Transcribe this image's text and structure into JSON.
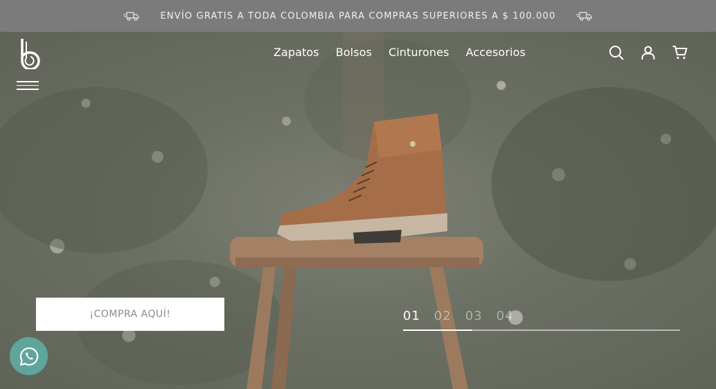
{
  "promo": {
    "text": "ENVÍO GRATIS A TODA COLOMBIA PARA COMPRAS SUPERIORES A $ 100.000",
    "left_icon": "delivery-truck-icon",
    "right_icon": "delivery-truck-icon"
  },
  "header": {
    "logo_icon": "brand-b-logo",
    "menu_icon": "hamburger-icon",
    "nav": [
      {
        "label": "Zapatos"
      },
      {
        "label": "Bolsos"
      },
      {
        "label": "Cinturones"
      },
      {
        "label": "Accesorios"
      }
    ],
    "icons": [
      "search-icon",
      "user-icon",
      "cart-icon"
    ]
  },
  "hero": {
    "cta_label": "¡COMPRA AQUÍ!",
    "slides": [
      "01",
      "02",
      "03",
      "04"
    ],
    "active_slide": "01",
    "progress_fraction": 0.25
  },
  "whatsapp": {
    "icon": "whatsapp-icon"
  },
  "colors": {
    "promo_bg": "#7b7b7b",
    "whatsapp": "#5fa59b",
    "cta_text": "#8a8a8a"
  }
}
